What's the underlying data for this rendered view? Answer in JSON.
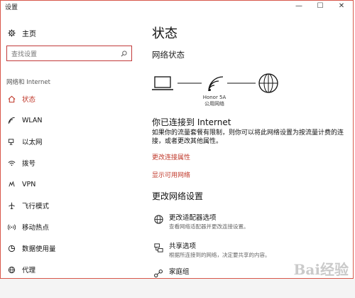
{
  "window": {
    "title": "设置",
    "controls": [
      "—",
      "☐",
      "✕"
    ]
  },
  "sidebar": {
    "home": {
      "label": "主页",
      "icon": "gear-icon"
    },
    "search": {
      "placeholder": "查找设置",
      "icon": "search-icon"
    },
    "section": "网络和 Internet",
    "items": [
      {
        "label": "状态",
        "icon": "home-icon",
        "active": true
      },
      {
        "label": "WLAN",
        "icon": "wifi-icon",
        "active": false
      },
      {
        "label": "以太网",
        "icon": "ethernet-icon",
        "active": false
      },
      {
        "label": "拨号",
        "icon": "dialup-icon",
        "active": false
      },
      {
        "label": "VPN",
        "icon": "vpn-icon",
        "active": false
      },
      {
        "label": "飞行模式",
        "icon": "airplane-icon",
        "active": false
      },
      {
        "label": "移动热点",
        "icon": "hotspot-icon",
        "active": false
      },
      {
        "label": "数据使用量",
        "icon": "data-usage-icon",
        "active": false
      },
      {
        "label": "代理",
        "icon": "globe-icon",
        "active": false
      }
    ]
  },
  "main": {
    "title": "状态",
    "network_status": "网络状态",
    "network_name": "Honor 5A",
    "network_type": "公用网络",
    "connected_title": "你已连接到 Internet",
    "description": "如果你的流量套餐有限制，则你可以将此网络设置为按流量计费的连接，或者更改其他属性。",
    "links": [
      "更改连接属性",
      "显示可用网络"
    ],
    "change_title": "更改网络设置",
    "options": [
      {
        "title": "更改适配器选项",
        "subtitle": "查看网络适配器并更改连接设置。",
        "icon": "adapter-icon"
      },
      {
        "title": "共享选项",
        "subtitle": "根据所连接到的网络，决定要共享的内容。",
        "icon": "sharing-icon"
      },
      {
        "title": "家庭组",
        "subtitle": "",
        "icon": "homegroup-icon"
      }
    ]
  },
  "watermark": "Bai经验",
  "accent_color": "#c0392b"
}
